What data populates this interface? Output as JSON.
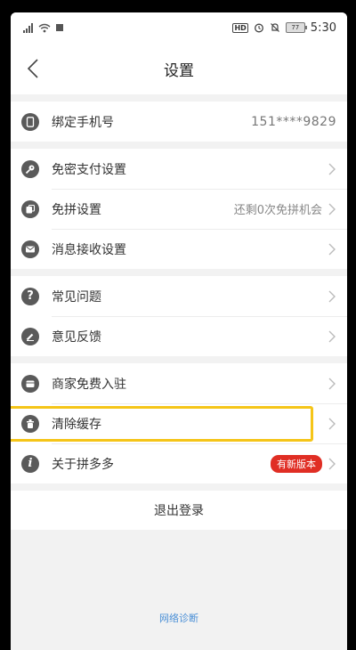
{
  "status_bar": {
    "wifi_icon": "wifi-icon",
    "hd_label": "HD",
    "battery": "77",
    "time": "5:30"
  },
  "header": {
    "title": "设置"
  },
  "groups": [
    {
      "items": [
        {
          "label": "绑定手机号",
          "value": "151****9829",
          "icon": "phone-icon"
        }
      ]
    },
    {
      "items": [
        {
          "label": "免密支付设置",
          "icon": "key-icon"
        },
        {
          "label": "免拼设置",
          "value": "还剩0次免拼机会",
          "icon": "coupon-icon"
        },
        {
          "label": "消息接收设置",
          "icon": "mail-icon"
        }
      ]
    },
    {
      "items": [
        {
          "label": "常见问题",
          "icon": "question-icon"
        },
        {
          "label": "意见反馈",
          "icon": "pen-icon"
        }
      ]
    },
    {
      "items": [
        {
          "label": "商家免费入驻",
          "icon": "store-icon"
        },
        {
          "label": "清除缓存",
          "icon": "trash-icon"
        },
        {
          "label": "关于拼多多",
          "badge": "有新版本",
          "icon": "info-icon"
        }
      ]
    }
  ],
  "logout_label": "退出登录",
  "network_diagnosis": "网络诊断",
  "colors": {
    "accent_red": "#e02e24",
    "highlight_yellow": "#f5c518",
    "link_blue": "#4a8fd6"
  }
}
